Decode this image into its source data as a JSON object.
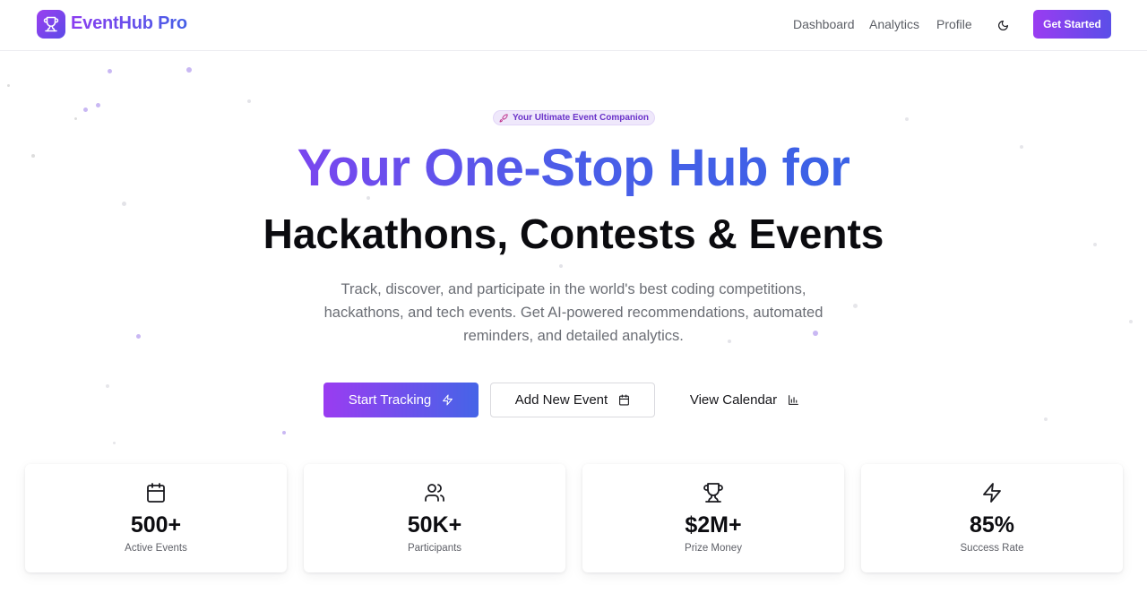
{
  "brand": {
    "name": "EventHub Pro",
    "logo_icon": "trophy-icon"
  },
  "nav": {
    "links": [
      "Dashboard",
      "Analytics",
      "Profile"
    ],
    "theme_icon": "moon-icon",
    "cta_label": "Get Started"
  },
  "hero": {
    "badge": "Your Ultimate Event Companion",
    "badge_icon": "rocket-icon",
    "title_line1": "Your One-Stop Hub for",
    "title_line2": "Hackathons, Contests & Events",
    "description": "Track, discover, and participate in the world's best coding competitions, hackathons, and tech events. Get AI-powered recommendations, automated reminders, and detailed analytics.",
    "buttons": {
      "primary": {
        "label": "Start Tracking",
        "icon": "lightning-icon"
      },
      "secondary": {
        "label": "Add New Event",
        "icon": "calendar-icon"
      },
      "tertiary": {
        "label": "View Calendar",
        "icon": "bar-chart-icon"
      }
    }
  },
  "stats": [
    {
      "value": "500+",
      "label": "Active Events",
      "icon": "calendar-icon"
    },
    {
      "value": "50K+",
      "label": "Participants",
      "icon": "users-icon"
    },
    {
      "value": "$2M+",
      "label": "Prize Money",
      "icon": "trophy-icon"
    },
    {
      "value": "85%",
      "label": "Success Rate",
      "icon": "lightning-icon"
    }
  ],
  "colors": {
    "accent_purple": "#9a3cf1",
    "accent_blue": "#4564e7",
    "badge_bg": "#efe8fb"
  }
}
